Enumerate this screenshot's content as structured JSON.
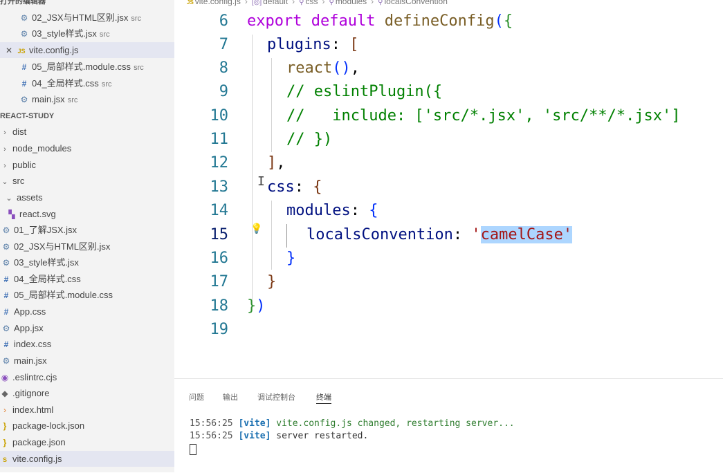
{
  "sidebar": {
    "open_editors_header": "打开的编辑器",
    "open_editors": [
      {
        "icon": "gear-icon",
        "name": "02_JSX与HTML区别.jsx",
        "desc": "src"
      },
      {
        "icon": "gear-icon",
        "name": "03_style样式.jsx",
        "desc": "src"
      },
      {
        "icon": "js-file-icon",
        "name": "vite.config.js",
        "desc": "",
        "selected": true
      },
      {
        "icon": "hash-icon",
        "name": "05_局部样式.module.css",
        "desc": "src"
      },
      {
        "icon": "hash-icon",
        "name": "04_全局样式.css",
        "desc": "src"
      },
      {
        "icon": "gear-icon",
        "name": "main.jsx",
        "desc": "src"
      }
    ],
    "project_header": "REACT-STUDY",
    "tree": [
      {
        "icon": "chevron-right-icon",
        "name": "dist"
      },
      {
        "icon": "chevron-right-icon",
        "name": "node_modules"
      },
      {
        "icon": "chevron-right-icon",
        "name": "public"
      },
      {
        "icon": "chevron-down-icon",
        "name": "src"
      },
      {
        "icon": "chevron-down-icon",
        "name": "assets"
      },
      {
        "icon": "svg-file-icon",
        "name": "react.svg"
      },
      {
        "icon": "gear-icon",
        "name": "01_了解JSX.jsx"
      },
      {
        "icon": "gear-icon",
        "name": "02_JSX与HTML区别.jsx"
      },
      {
        "icon": "gear-icon",
        "name": "03_style样式.jsx"
      },
      {
        "icon": "hash-icon",
        "name": "04_全局样式.css"
      },
      {
        "icon": "hash-icon",
        "name": "05_局部样式.module.css"
      },
      {
        "icon": "hash-icon",
        "name": "App.css"
      },
      {
        "icon": "gear-icon",
        "name": "App.jsx"
      },
      {
        "icon": "hash-icon",
        "name": "index.css"
      },
      {
        "icon": "gear-icon",
        "name": "main.jsx"
      },
      {
        "icon": "eslint-icon",
        "name": ".eslintrc.cjs"
      },
      {
        "icon": "git-icon",
        "name": ".gitignore"
      },
      {
        "icon": "html-file-icon",
        "name": "index.html"
      },
      {
        "icon": "json-file-icon",
        "name": "package-lock.json"
      },
      {
        "icon": "json-file-icon",
        "name": "package.json"
      },
      {
        "icon": "js-file-icon",
        "name": "vite.config.js",
        "selected": true
      }
    ]
  },
  "breadcrumb": {
    "items": [
      "vite.config.js",
      "default",
      "css",
      "modules",
      "localsConvention"
    ]
  },
  "editor": {
    "line_numbers": [
      "6",
      "7",
      "8",
      "9",
      "10",
      "11",
      "12",
      "13",
      "14",
      "15",
      "16",
      "17",
      "18",
      "19"
    ],
    "current_line": "15",
    "lines": {
      "l6": {
        "kw1": "export",
        "kw2": "default",
        "fn": "defineConfig",
        "p1": "(",
        "b1": "{"
      },
      "l7": {
        "prop": "plugins",
        "punct": ": ",
        "b": "["
      },
      "l8": {
        "fn": "react",
        "paren": "()",
        "punct": ","
      },
      "l9": {
        "text": "// eslintPlugin({"
      },
      "l10": {
        "text": "//   include: ['src/*.jsx', 'src/**/*.jsx']"
      },
      "l11": {
        "text": "// })"
      },
      "l12": {
        "b": "]",
        "punct": ","
      },
      "l13": {
        "prop": "css",
        "punct": ": ",
        "b": "{"
      },
      "l14": {
        "prop": "modules",
        "punct": ": ",
        "b": "{"
      },
      "l15": {
        "prop": "localsConvention",
        "punct": ": ",
        "q1": "'",
        "value": "camelCase",
        "q2": "'"
      },
      "l16": {
        "b": "}"
      },
      "l17": {
        "b": "}"
      },
      "l18": {
        "b1": "}",
        "p1": ")"
      }
    }
  },
  "panel": {
    "tabs": [
      "问题",
      "输出",
      "调试控制台",
      "终端"
    ],
    "active_tab": "终端",
    "terminal": [
      {
        "time": "15:56:25",
        "tag": "[vite]",
        "msg": "vite.config.js changed, restarting server..."
      },
      {
        "time": "15:56:25",
        "tag": "[vite]",
        "msg": "server restarted."
      }
    ]
  },
  "colors": {
    "keyword": "#af00db",
    "function": "#795e26",
    "property": "#001080",
    "comment": "#008000",
    "string": "#a31515",
    "selection": "#add6ff",
    "line_number": "#237893",
    "sidebar_bg": "#f3f3f3",
    "selected_row": "#e4e6f1"
  }
}
